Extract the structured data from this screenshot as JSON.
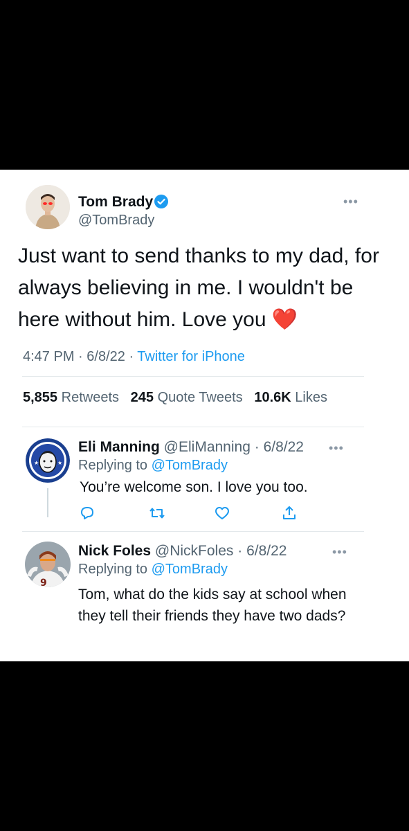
{
  "tweet": {
    "author_name": "Tom Brady",
    "author_handle": "@TomBrady",
    "text": "Just want to send thanks to my dad, for always believing in me. I wouldn't be here without him. Love you ❤️",
    "time": "4:47 PM",
    "date": "6/8/22",
    "source": "Twitter for iPhone",
    "stats": {
      "retweets_count": "5,855",
      "retweets_label": "Retweets",
      "quotes_count": "245",
      "quotes_label": "Quote Tweets",
      "likes_count": "10.6K",
      "likes_label": "Likes"
    }
  },
  "replies": [
    {
      "name": "Eli Manning",
      "handle": "@EliManning",
      "date": "6/8/22",
      "replying_prefix": "Replying to",
      "replying_to": "@TomBrady",
      "text": "You’re welcome son. I love you too."
    },
    {
      "name": "Nick Foles",
      "handle": "@NickFoles",
      "date": "6/8/22",
      "replying_prefix": "Replying to",
      "replying_to": "@TomBrady",
      "text": "Tom, what do the kids say at school when they tell their friends they have two dads?"
    }
  ],
  "icons": [
    "verified-badge-icon",
    "more-icon",
    "reply-icon",
    "retweet-icon",
    "like-icon",
    "share-icon"
  ],
  "colors": {
    "accent": "#1d9bf0",
    "text": "#0f1419",
    "muted": "#536471",
    "heart": "#e0245e"
  }
}
